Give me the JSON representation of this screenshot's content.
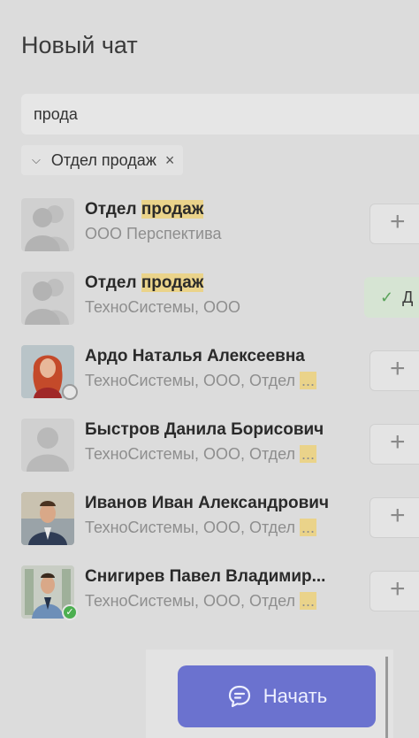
{
  "header": {
    "title": "Новый чат"
  },
  "search": {
    "value": "прода"
  },
  "filter_chip": {
    "label": "Отдел продаж",
    "expand_icon": "chevron-down-icon",
    "remove_icon": "close-icon"
  },
  "results": [
    {
      "name_pre": "Отдел ",
      "name_match": "продаж",
      "name_post": "",
      "subtitle": "ООО Перспектива",
      "truncated": false,
      "avatar": "group-placeholder",
      "status": "",
      "action": "add",
      "action_label": "+"
    },
    {
      "name_pre": "Отдел ",
      "name_match": "продаж",
      "name_post": "",
      "subtitle": "ТехноСистемы, ООО",
      "truncated": false,
      "avatar": "group-placeholder",
      "status": "",
      "action": "added",
      "action_label": "Д"
    },
    {
      "name_pre": "Ардо Наталья Алексеевна",
      "name_match": "",
      "name_post": "",
      "subtitle": "ТехноСистемы, ООО, Отдел ",
      "truncated": true,
      "avatar": "photo-redhair",
      "status": "away",
      "action": "add",
      "action_label": "+"
    },
    {
      "name_pre": "Быстров Данила Борисович",
      "name_match": "",
      "name_post": "",
      "subtitle": "ТехноСистемы, ООО, Отдел ",
      "truncated": true,
      "avatar": "person-placeholder",
      "status": "",
      "action": "add",
      "action_label": "+"
    },
    {
      "name_pre": "Иванов Иван Александрович",
      "name_match": "",
      "name_post": "",
      "subtitle": "ТехноСистемы, ООО, Отдел ",
      "truncated": true,
      "avatar": "photo-man-suit",
      "status": "",
      "action": "add",
      "action_label": "+"
    },
    {
      "name_pre": "Снигирев Павел Владимир...",
      "name_match": "",
      "name_post": "",
      "subtitle": "ТехноСистемы, ООО, Отдел ",
      "truncated": true,
      "avatar": "photo-man-office",
      "status": "online",
      "action": "add",
      "action_label": "+"
    }
  ],
  "ellipsis": "...",
  "footer": {
    "start_label": "Начать",
    "start_icon": "chat-bubble-icon"
  },
  "colors": {
    "background": "#dcdcdc",
    "highlight": "#ead38a",
    "primary_button": "#6b72cf",
    "added_bg": "#d6e4d3",
    "online": "#4caf50"
  }
}
